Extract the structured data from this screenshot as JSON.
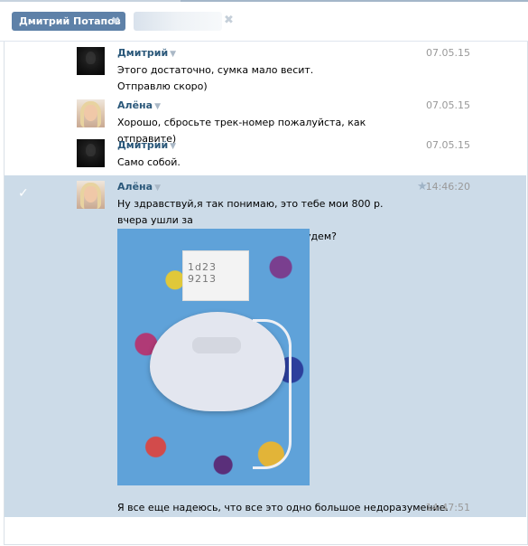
{
  "tabs": {
    "active_label": "Дмитрий Потапов",
    "close_glyph": "✖"
  },
  "messages": [
    {
      "author": "Дмитрий",
      "date": "07.05.15",
      "lines": [
        "Этого достаточно, сумка мало весит.",
        "Отправлю скоро)"
      ]
    },
    {
      "author": "Алёна",
      "date": "07.05.15",
      "lines": [
        "Хорошо, сбросьте трек-номер пожалуйста, как отправите)"
      ]
    },
    {
      "author": "Дмитрий",
      "date": "07.05.15",
      "lines": [
        "Само собой."
      ]
    },
    {
      "author": "Алёна",
      "date": "14:46:20",
      "lines": [
        "Ну здравствуй,я так понимаю, это тебе мои 800 р. вчера ушли за",
        "эту сумку? Так что делать теперь будем?"
      ],
      "caption": "Я все еще надеюсь, что все это одно большое недоразумение.",
      "caption_time": "14:47:51"
    }
  ],
  "icons": {
    "caret": "▼",
    "star": "★",
    "check": "✓"
  },
  "colors": {
    "author": "#2b587a",
    "selected_bg": "#ccdbe8",
    "tab_active": "#5e81a8"
  }
}
